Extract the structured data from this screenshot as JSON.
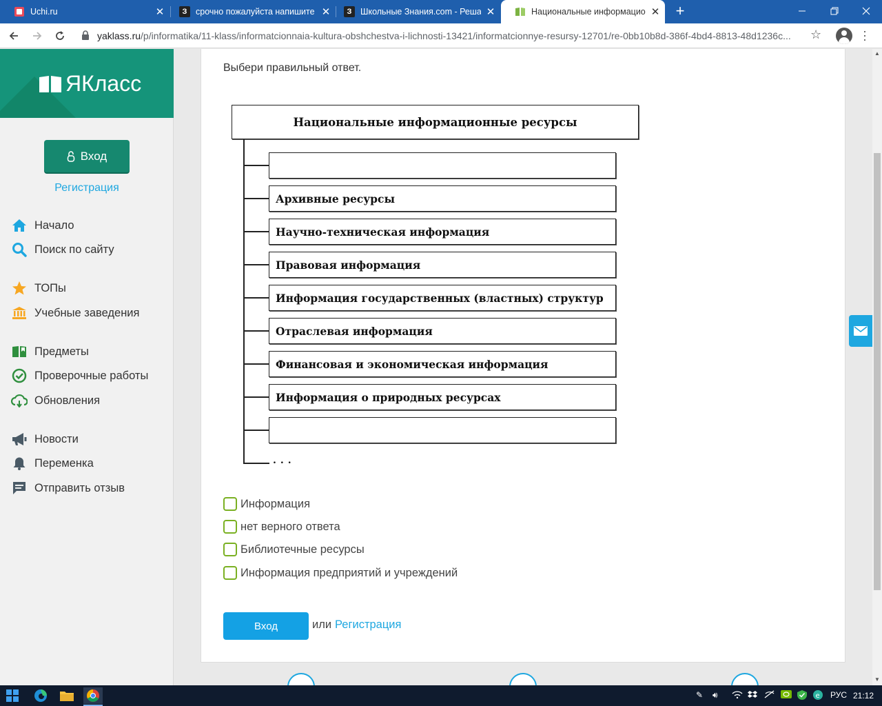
{
  "browser": {
    "tabs": [
      {
        "title": "Uchi.ru",
        "close": "✕"
      },
      {
        "title": "срочно пожалуйста напишите б",
        "close": "✕"
      },
      {
        "title": "Школьные Знания.com - Решае",
        "close": "✕"
      },
      {
        "title": "Национальные информационн",
        "close": "✕"
      }
    ],
    "new_tab": "+",
    "url_host": "yaklass.ru",
    "url_path": "/p/informatika/11-klass/informatcionnaia-kultura-obshchestva-i-lichnosti-13421/informatcionnye-resursy-12701/re-0bb10b8d-386f-4bd4-8813-48d1236c..."
  },
  "sidebar": {
    "logo": "ЯКласс",
    "login_button": "Вход",
    "register_link": "Регистрация",
    "items": [
      {
        "label": "Начало",
        "icon": "home-icon"
      },
      {
        "label": "Поиск по сайту",
        "icon": "search-icon"
      },
      {
        "label": "ТОПы",
        "icon": "star-icon"
      },
      {
        "label": "Учебные заведения",
        "icon": "institution-icon"
      },
      {
        "label": "Предметы",
        "icon": "book-icon"
      },
      {
        "label": "Проверочные работы",
        "icon": "check-circle-icon"
      },
      {
        "label": "Обновления",
        "icon": "cloud-icon"
      },
      {
        "label": "Новости",
        "icon": "megaphone-icon"
      },
      {
        "label": "Переменка",
        "icon": "bell-icon"
      },
      {
        "label": "Отправить отзыв",
        "icon": "comment-icon"
      }
    ]
  },
  "task": {
    "prompt": "Выбери правильный ответ.",
    "diagram": {
      "title": "Национальные информационные ресурсы",
      "boxes": [
        "",
        "Архивные ресурсы",
        "Научно-техническая информация",
        "Правовая информация",
        "Информация государственных (властных) структур",
        "Отраслевая информация",
        "Финансовая и экономическая информация",
        "Информация о природных ресурсах",
        ""
      ],
      "ellipsis": "..."
    },
    "options": [
      "Информация",
      "нет верного ответа",
      "Библиотечные ресурсы",
      "Информация предприятий и учреждений"
    ],
    "login_button": "Вход",
    "or_text": "или",
    "register_link": "Регистрация"
  },
  "taskbar": {
    "language": "РУС",
    "time": "21:12"
  },
  "colors": {
    "brand_green": "#15947a",
    "link_blue": "#1ea7e0",
    "checkbox_green": "#7ab022",
    "tabbar_blue": "#1f5fad"
  }
}
